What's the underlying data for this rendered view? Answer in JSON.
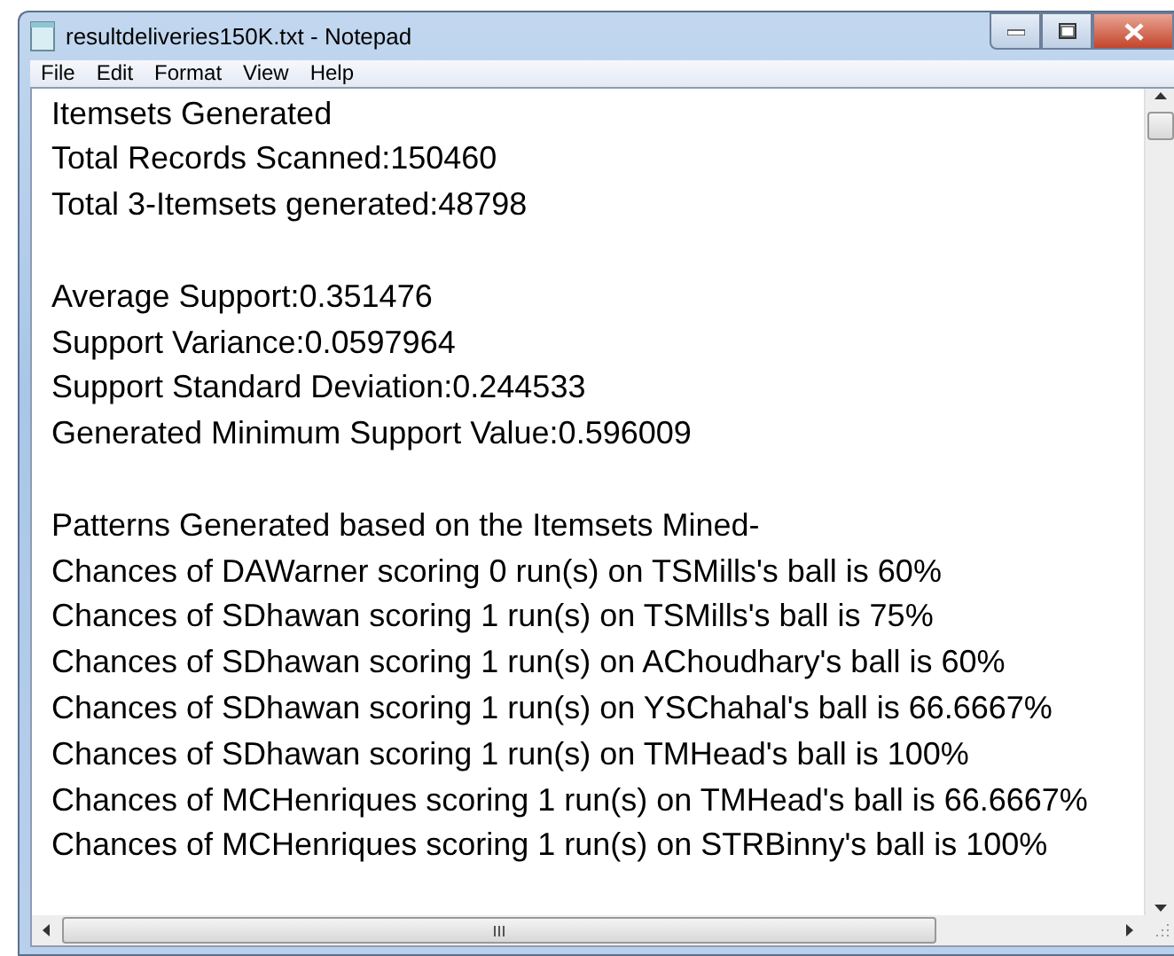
{
  "window": {
    "title": "resultdeliveries150K.txt - Notepad"
  },
  "menu": [
    "File",
    "Edit",
    "Format",
    "View",
    "Help"
  ],
  "text_blocks": [
    [
      "Itemsets Generated",
      "Total Records Scanned:150460",
      "Total 3-Itemsets generated:48798"
    ],
    [
      "Average Support:0.351476",
      "Support Variance:0.0597964",
      "Support Standard Deviation:0.244533",
      "Generated Minimum Support Value:0.596009"
    ],
    [
      "Patterns Generated based on the Itemsets Mined-",
      "Chances of DAWarner scoring 0 run(s) on TSMills's ball is 60%",
      "Chances of SDhawan scoring 1 run(s) on TSMills's ball is 75%",
      "Chances of SDhawan scoring 1 run(s) on AChoudhary's ball is 60%",
      "Chances of SDhawan scoring 1 run(s) on YSChahal's ball is 66.6667%",
      "Chances of SDhawan scoring 1 run(s) on TMHead's ball is 100%",
      "Chances of MCHenriques scoring 1 run(s) on TMHead's ball is 66.6667%",
      "Chances of MCHenriques scoring 1 run(s) on STRBinny's ball is 100%"
    ]
  ]
}
